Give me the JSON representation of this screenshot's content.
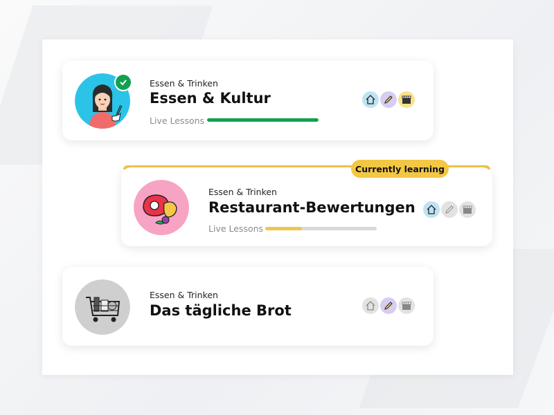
{
  "courses": [
    {
      "category": "Essen & Trinken",
      "title": "Essen & Kultur",
      "lessons_label": "Live Lessons",
      "progress": 1.0,
      "progress_color": "#12a150",
      "completed": true,
      "avatar_icon": "girl-eating-noodles-icon",
      "avatar_bg": "#2cc3e8",
      "skills": [
        {
          "icon": "house-icon",
          "active": true,
          "bg": "#bfe3f2"
        },
        {
          "icon": "pencil-icon",
          "active": true,
          "bg": "#d7cdf3"
        },
        {
          "icon": "clapperboard-icon",
          "active": true,
          "bg": "#fbe28a"
        }
      ]
    },
    {
      "category": "Essen & Trinken",
      "title": "Restaurant-Bewertungen",
      "lessons_label": "Live Lessons",
      "progress": 0.33,
      "progress_color": "#f0c64a",
      "current": true,
      "current_label": "Currently learning",
      "avatar_icon": "steak-and-fruit-icon",
      "avatar_bg": "#f7a3c4",
      "skills": [
        {
          "icon": "house-icon",
          "active": true,
          "bg": "#bfe3f2"
        },
        {
          "icon": "pencil-icon",
          "active": false,
          "bg": "#e2e2e2"
        },
        {
          "icon": "clapperboard-icon",
          "active": false,
          "bg": "#e2e2e2"
        }
      ]
    },
    {
      "category": "Essen & Trinken",
      "title": "Das tägliche Brot",
      "locked": true,
      "avatar_icon": "shopping-cart-icon",
      "avatar_bg": "#cfcfcf",
      "skills": [
        {
          "icon": "house-icon",
          "active": false,
          "bg": "#e2e2e2"
        },
        {
          "icon": "pencil-icon",
          "active": true,
          "bg": "#d7cdf3"
        },
        {
          "icon": "clapperboard-icon",
          "active": false,
          "bg": "#e2e2e2"
        }
      ]
    }
  ]
}
